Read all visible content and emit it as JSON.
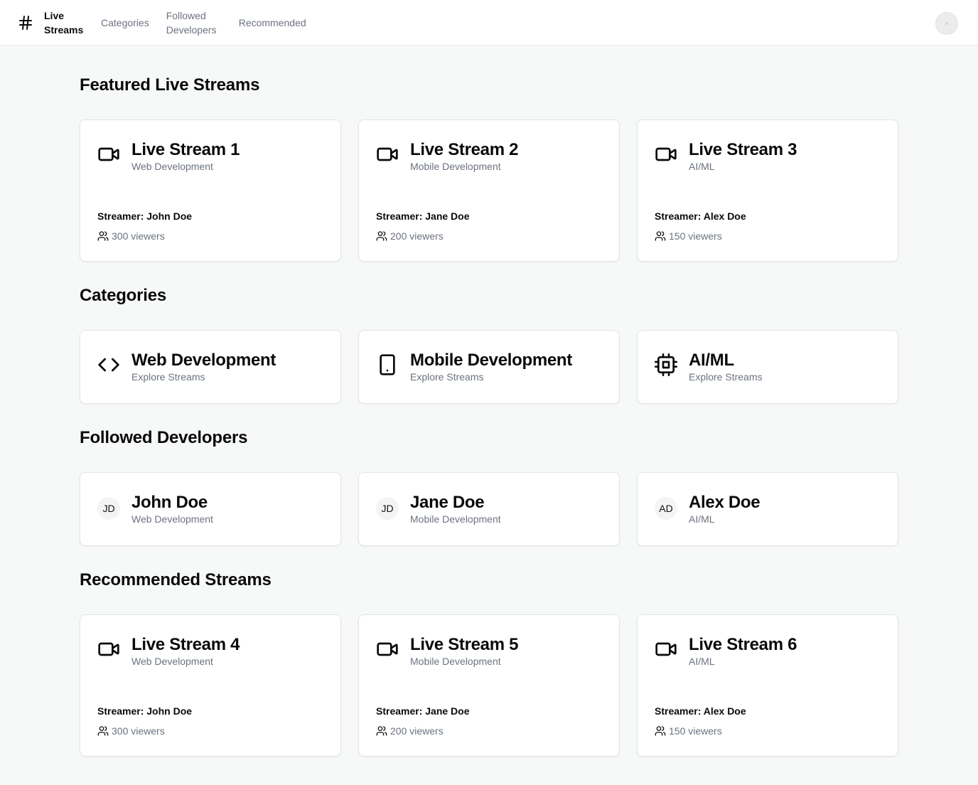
{
  "header": {
    "brand": "Live Streams",
    "nav": [
      "Categories",
      "Followed Developers",
      "Recommended"
    ]
  },
  "featured": {
    "title": "Featured Live Streams",
    "items": [
      {
        "title": "Live Stream 1",
        "category": "Web Development",
        "streamer": "Streamer: John Doe",
        "viewers": "300 viewers"
      },
      {
        "title": "Live Stream 2",
        "category": "Mobile Development",
        "streamer": "Streamer: Jane Doe",
        "viewers": "200 viewers"
      },
      {
        "title": "Live Stream 3",
        "category": "AI/ML",
        "streamer": "Streamer: Alex Doe",
        "viewers": "150 viewers"
      }
    ]
  },
  "categories": {
    "title": "Categories",
    "items": [
      {
        "title": "Web Development",
        "sub": "Explore Streams",
        "icon": "code-icon"
      },
      {
        "title": "Mobile Development",
        "sub": "Explore Streams",
        "icon": "tablet-icon"
      },
      {
        "title": "AI/ML",
        "sub": "Explore Streams",
        "icon": "cpu-icon"
      }
    ]
  },
  "followed": {
    "title": "Followed Developers",
    "items": [
      {
        "initials": "JD",
        "name": "John Doe",
        "category": "Web Development"
      },
      {
        "initials": "JD",
        "name": "Jane Doe",
        "category": "Mobile Development"
      },
      {
        "initials": "AD",
        "name": "Alex Doe",
        "category": "AI/ML"
      }
    ]
  },
  "recommended": {
    "title": "Recommended Streams",
    "items": [
      {
        "title": "Live Stream 4",
        "category": "Web Development",
        "streamer": "Streamer: John Doe",
        "viewers": "300 viewers"
      },
      {
        "title": "Live Stream 5",
        "category": "Mobile Development",
        "streamer": "Streamer: Jane Doe",
        "viewers": "200 viewers"
      },
      {
        "title": "Live Stream 6",
        "category": "AI/ML",
        "streamer": "Streamer: Alex Doe",
        "viewers": "150 viewers"
      }
    ]
  }
}
